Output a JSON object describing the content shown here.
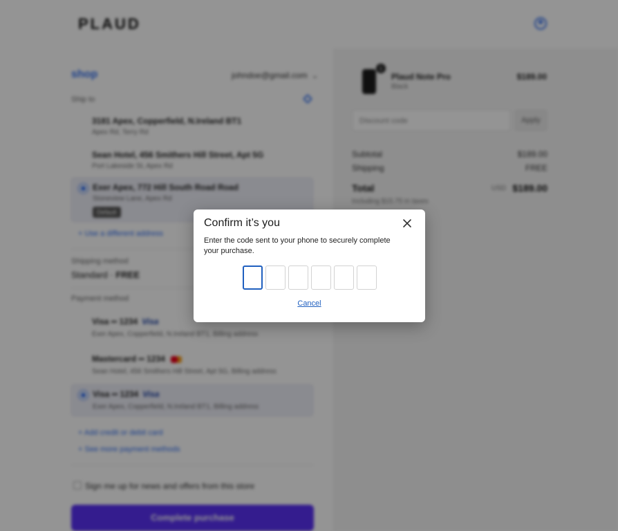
{
  "page": {
    "logo": "PLAUD",
    "shop_name": "shop",
    "account_email": "johndoe@gmail.com",
    "ship_to_label": "Ship to",
    "addresses": [
      {
        "title": "3181 Apex, Copperfield, N.Ireland BT1",
        "sub": "Apex Rd, Terry Rd"
      },
      {
        "title": "Sean Hotel, 456 Smithers Hill Street, Apt 5G",
        "sub": "Port Lakeside St, Apex Rd"
      },
      {
        "title": "Exer Apex, 772 Hill South Road Road",
        "sub": "Stoneview Lane, Apex Rd",
        "badge": "Default"
      }
    ],
    "add_address_link": "Use a different address",
    "shipping_method_label": "Shipping method",
    "shipping_method_name": "Standard",
    "shipping_method_price": "FREE",
    "payment_label": "Payment method",
    "payments": [
      {
        "title": "Visa •• 1234",
        "brand": "Visa",
        "sub": "Exer Apex, Copperfield, N.Ireland BT1, Billing address"
      },
      {
        "title": "Mastercard •• 1234",
        "brand": "",
        "sub": "Sean Hotel, 456 Smithers Hill Street, Apt 5G, Billing address"
      },
      {
        "title": "Visa •• 1234",
        "brand": "Visa",
        "sub": "Exer Apex, Copperfield, N.Ireland BT1, Billing address"
      }
    ],
    "add_card_link": "Add credit or debit card",
    "other_payment_link": "See more payment methods",
    "opt_in_text": "Sign me up for news and offers from this store",
    "cta_label": "Complete purchase",
    "order": {
      "qty": "1",
      "product_name": "Plaud Note Pro",
      "product_sub": "Black",
      "product_price": "$189.00",
      "discount_placeholder": "Discount code",
      "apply_label": "Apply",
      "subtotal_label": "Subtotal",
      "subtotal_value": "$189.00",
      "shipping_label": "Shipping",
      "shipping_value": "FREE",
      "total_label": "Total",
      "total_currency": "USD",
      "total_value": "$189.00",
      "tax_note": "Including $15.75 in taxes"
    }
  },
  "modal": {
    "title": "Confirm it’s you",
    "description": "Enter the code sent to your phone to securely complete your purchase.",
    "code_digits": [
      "",
      "",
      "",
      "",
      "",
      ""
    ],
    "cancel_label": "Cancel",
    "close_icon": "close-icon"
  },
  "colors": {
    "accent": "#1f5fbf",
    "cta": "#5a31f4",
    "overlay": "rgba(0,0,0,0.42)"
  }
}
